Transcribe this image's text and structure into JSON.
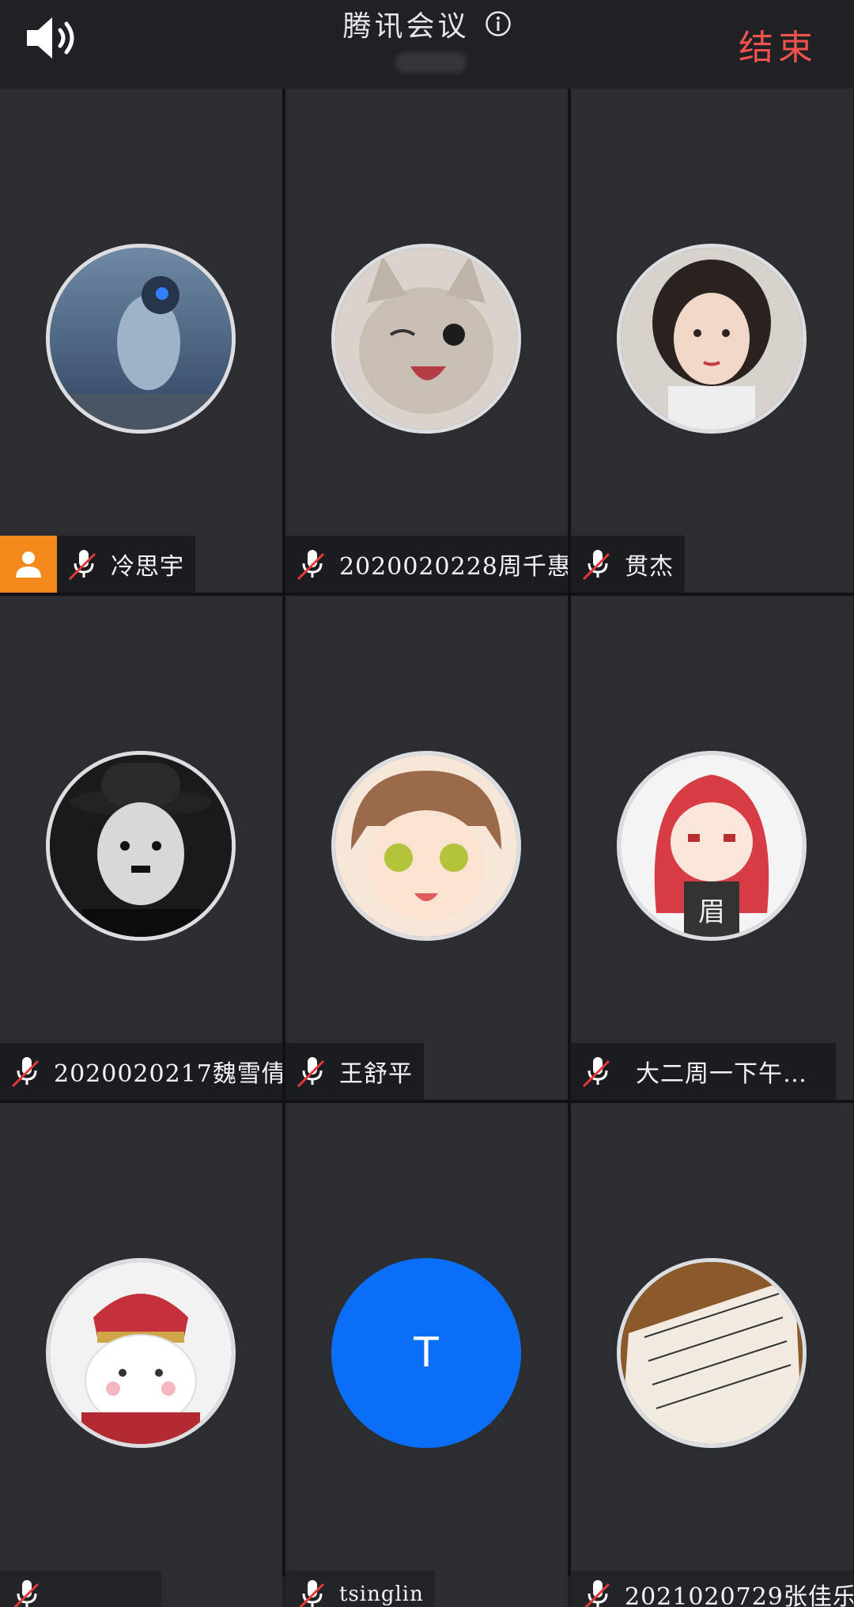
{
  "header": {
    "title": "腾讯会议",
    "end_label": "结束",
    "speaker_icon": "speaker-icon",
    "info_icon": "info-icon"
  },
  "colors": {
    "end": "#f0524e",
    "host_badge": "#f48a1b",
    "letter_avatar": "#0b6ef6",
    "mic_muted_slash": "#e53935"
  },
  "participants": [
    {
      "name": "冷思宇",
      "host": true,
      "muted": true,
      "avatar": "astronaut-avatar"
    },
    {
      "name": "2020020228周千惠",
      "host": false,
      "muted": true,
      "avatar": "kitten-avatar"
    },
    {
      "name": "贯杰",
      "host": false,
      "muted": true,
      "avatar": "girl-portrait-avatar"
    },
    {
      "name": "2020020217魏雪倩",
      "host": false,
      "muted": true,
      "avatar": "chaplin-avatar"
    },
    {
      "name": "王舒平",
      "host": false,
      "muted": true,
      "avatar": "anime-boy-avatar"
    },
    {
      "name": "大二周一下午…",
      "host": false,
      "muted": true,
      "avatar": "anime-girl-red-hair-avatar"
    },
    {
      "name": "",
      "host": false,
      "muted": true,
      "avatar": "hamster-soldier-avatar"
    },
    {
      "name": "tsinglin",
      "host": false,
      "muted": true,
      "avatar": "letter-avatar",
      "letter": "T"
    },
    {
      "name": "2021020729张佳乐",
      "host": false,
      "muted": true,
      "avatar": "handwriting-notebook-avatar"
    }
  ]
}
